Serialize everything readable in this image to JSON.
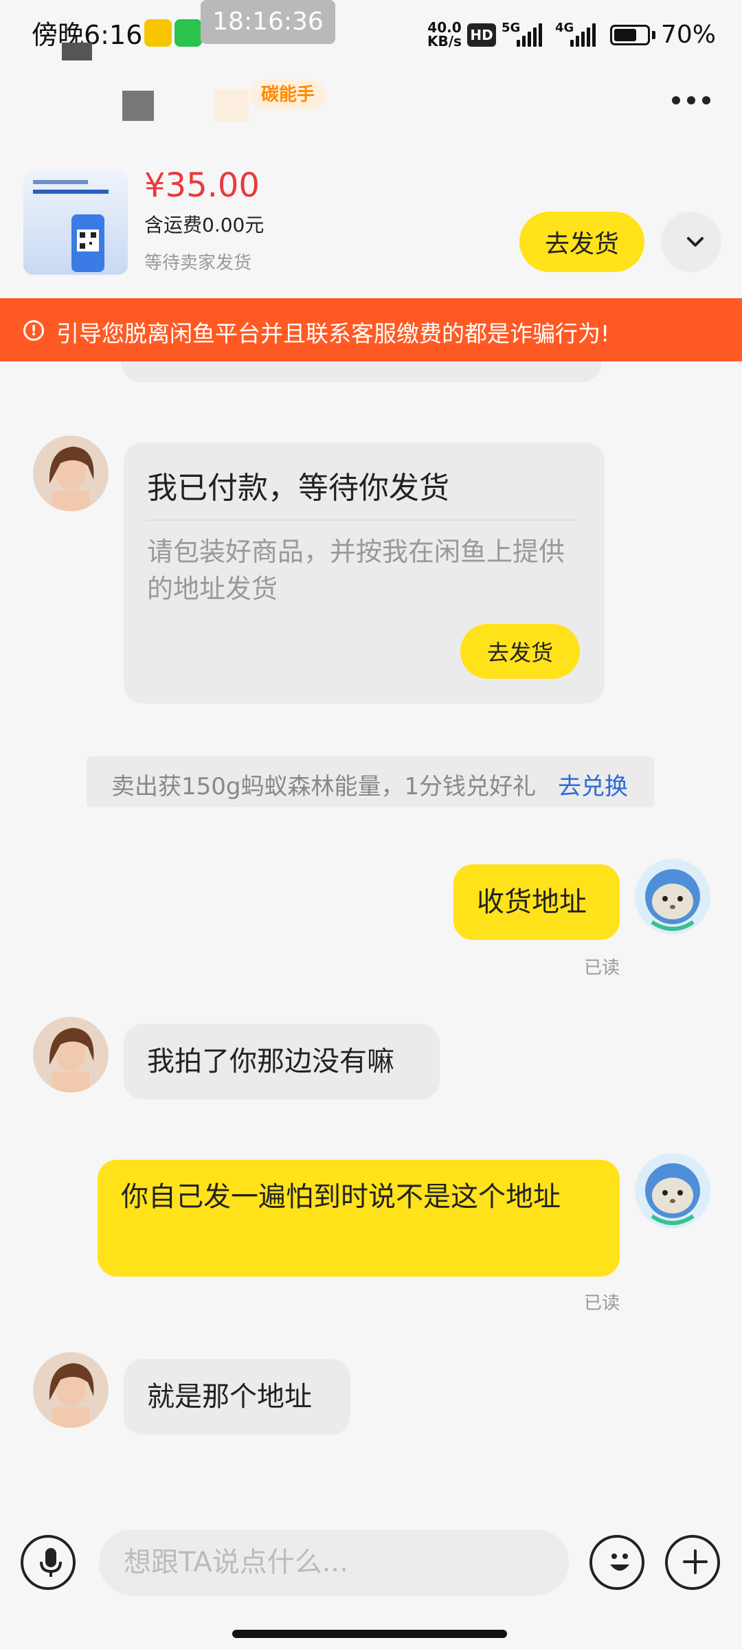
{
  "status_bar": {
    "time": "傍晚6:16",
    "clock": "18:16:36",
    "net_speed_value": "40.0",
    "net_speed_unit": "KB/s",
    "hd": "HD",
    "sim1": "5G",
    "sim2": "4G",
    "battery": "70%",
    "battery_level": 0.7
  },
  "header": {
    "tag": "碳能手"
  },
  "product": {
    "price": "¥35.00",
    "shipping": "含运费0.00元",
    "status": "等待卖家发货",
    "ship_button": "去发货"
  },
  "warning": {
    "text": "引导您脱离闲鱼平台并且联系客服缴费的都是诈骗行为!"
  },
  "messages": {
    "payment_card": {
      "title": "我已付款，等待你发货",
      "body": "请包装好商品，并按我在闲鱼上提供的地址发货",
      "button": "去发货"
    },
    "notice": {
      "text": "卖出获150g蚂蚁森林能量，1分钱兑好礼",
      "link": "去兑换"
    },
    "out_1": "收货地址",
    "read_1": "已读",
    "in_1": "我拍了你那边没有嘛",
    "out_2": "你自己发一遍怕到时说不是这个地址",
    "read_2": "已读",
    "in_2": "就是那个地址"
  },
  "input": {
    "placeholder": "想跟TA说点什么..."
  },
  "colors": {
    "accent_yellow": "#ffe21a",
    "warning_orange": "#ff5a24",
    "price_red": "#e8393f",
    "link_blue": "#2a6ad8"
  },
  "icons": [
    "voice-icon",
    "emoji-icon",
    "plus-icon",
    "more-icon",
    "chevron-down-icon",
    "warning-icon"
  ]
}
